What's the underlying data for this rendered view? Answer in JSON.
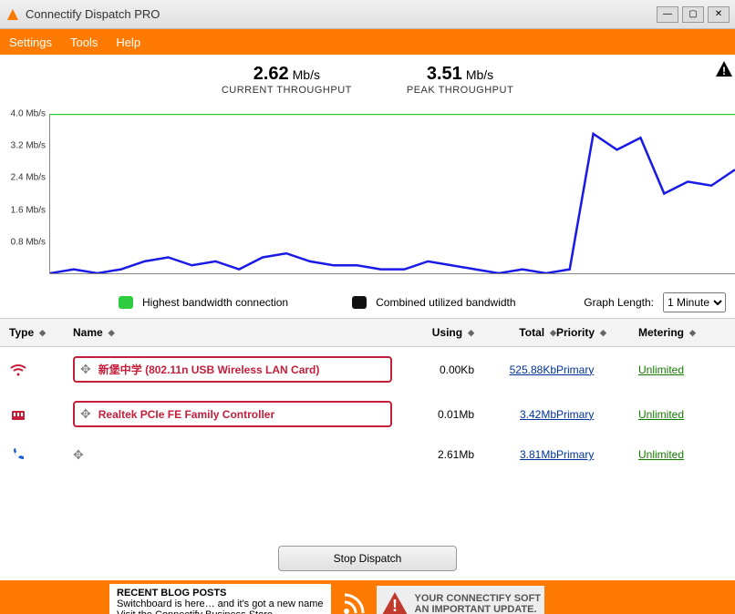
{
  "window": {
    "title": "Connectify Dispatch PRO"
  },
  "menu": {
    "settings": "Settings",
    "tools": "Tools",
    "help": "Help"
  },
  "throughput": {
    "current_value": "2.62",
    "current_unit": "Mb/s",
    "current_label": "CURRENT THROUGHPUT",
    "peak_value": "3.51",
    "peak_unit": "Mb/s",
    "peak_label": "PEAK THROUGHPUT"
  },
  "chart_data": {
    "type": "line",
    "ylabel": "Mb/s",
    "ylim": [
      0,
      4.0
    ],
    "yticks": [
      "4.0 Mb/s",
      "3.2 Mb/s",
      "2.4 Mb/s",
      "1.6 Mb/s",
      "0.8 Mb/s"
    ],
    "x_window_seconds": 60,
    "series": [
      {
        "name": "Highest bandwidth connection",
        "color": "#2ecc40",
        "values": [
          4.0,
          4.0,
          4.0,
          4.0,
          4.0,
          4.0,
          4.0,
          4.0,
          4.0,
          4.0,
          4.0,
          4.0,
          4.0,
          4.0,
          4.0,
          4.0,
          4.0,
          4.0,
          4.0,
          4.0,
          4.0,
          4.0,
          4.0,
          4.0,
          4.0,
          4.0,
          4.0,
          4.0,
          4.0,
          4.0
        ]
      },
      {
        "name": "Combined utilized bandwidth",
        "color": "#1a1ae6",
        "values": [
          0.0,
          0.1,
          0.0,
          0.1,
          0.3,
          0.4,
          0.2,
          0.3,
          0.1,
          0.4,
          0.5,
          0.3,
          0.2,
          0.2,
          0.1,
          0.1,
          0.3,
          0.2,
          0.1,
          0.0,
          0.1,
          0.0,
          0.1,
          3.5,
          3.1,
          3.4,
          2.0,
          2.3,
          2.2,
          2.6
        ]
      }
    ]
  },
  "legend": {
    "highest": "Highest bandwidth connection",
    "combined": "Combined utilized bandwidth",
    "graph_length_label": "Graph Length:",
    "graph_length_value": "1 Minute"
  },
  "table": {
    "headers": {
      "type": "Type",
      "name": "Name",
      "using": "Using",
      "total": "Total",
      "priority": "Priority",
      "metering": "Metering"
    },
    "rows": [
      {
        "icon": "wifi",
        "highlighted": true,
        "name": "新堡中学 (802.11n USB Wireless LAN Card)",
        "using": "0.00Kb",
        "total": "525.88Kb",
        "priority": "Primary",
        "metering": "Unlimited"
      },
      {
        "icon": "ethernet",
        "highlighted": true,
        "name": "Realtek PCIe FE Family Controller",
        "using": "0.01Mb",
        "total": "3.42Mb",
        "priority": "Primary",
        "metering": "Unlimited"
      },
      {
        "icon": "dialup",
        "highlighted": false,
        "name": "",
        "using": "2.61Mb",
        "total": "3.81Mb",
        "priority": "Primary",
        "metering": "Unlimited"
      }
    ]
  },
  "stop_button": "Stop Dispatch",
  "footer": {
    "blog_title": "RECENT BLOG POSTS",
    "blog_line1": "Switchboard is here… and it's got a new name",
    "blog_line2": "Visit the Connectify Business Store",
    "update_line1": "YOUR CONNECTIFY SOFT",
    "update_line2": "AN IMPORTANT UPDATE."
  }
}
